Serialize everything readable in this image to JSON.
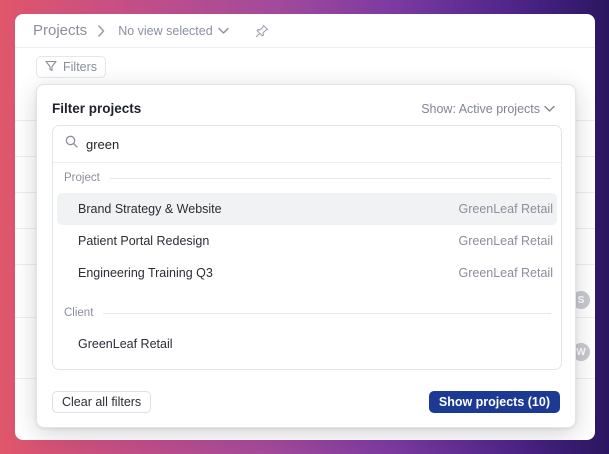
{
  "header": {
    "breadcrumb_title": "Projects",
    "view_select_label": "No view selected"
  },
  "toolbar": {
    "filters_label": "Filters"
  },
  "background_avatars": [
    "S",
    "W"
  ],
  "popover": {
    "title": "Filter projects",
    "show_select_label": "Show: Active projects",
    "search": {
      "value": "green",
      "placeholder": ""
    },
    "groups": [
      {
        "label": "Project",
        "items": [
          {
            "name": "Brand Strategy & Website",
            "meta": "GreenLeaf Retail",
            "highlighted": true
          },
          {
            "name": "Patient Portal Redesign",
            "meta": "GreenLeaf Retail",
            "highlighted": false
          },
          {
            "name": "Engineering Training Q3",
            "meta": "GreenLeaf Retail",
            "highlighted": false
          }
        ]
      },
      {
        "label": "Client",
        "items": [
          {
            "name": "GreenLeaf Retail",
            "meta": "",
            "highlighted": false
          }
        ]
      }
    ],
    "footer": {
      "clear_label": "Clear all filters",
      "show_label": "Show projects (10)"
    }
  },
  "colors": {
    "primary_button": "#1c3a94",
    "highlight_row": "#f1f2f4"
  }
}
